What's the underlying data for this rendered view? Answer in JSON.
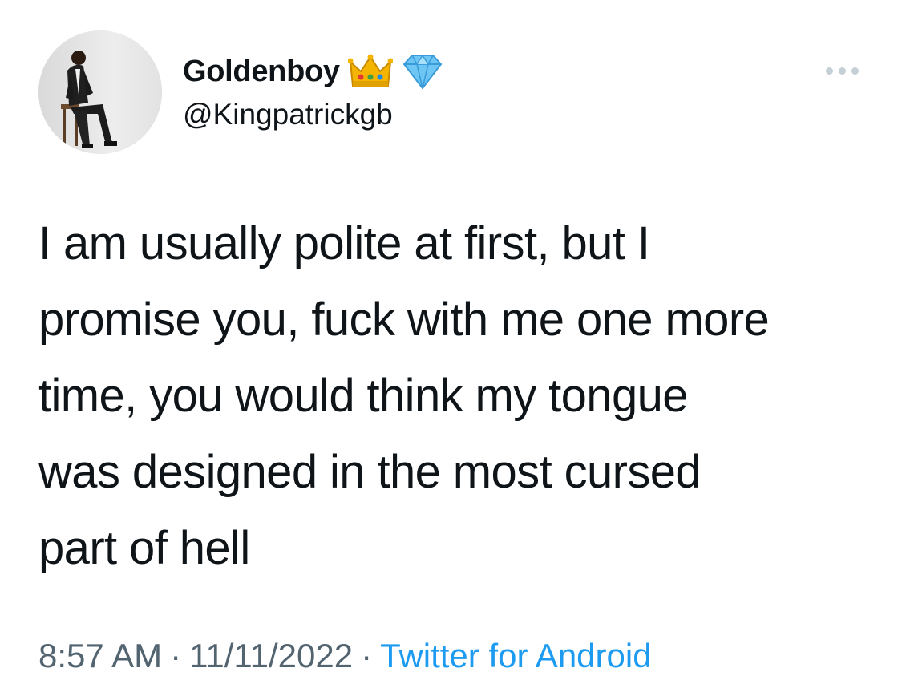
{
  "user": {
    "display_name": "Goldenboy",
    "handle": "@Kingpatrickgb",
    "badges": [
      "crown-emoji",
      "gem-emoji"
    ]
  },
  "tweet": {
    "lines": [
      "I am usually polite at first, but I",
      "promise you, fuck with me one more",
      "time, you would think my tongue",
      "was designed in the most cursed",
      "part of hell"
    ]
  },
  "meta": {
    "time": "8:57 AM",
    "separator": "·",
    "date": "11/11/2022",
    "source": "Twitter for Android"
  },
  "colors": {
    "text": "#0f1419",
    "secondary": "#536471",
    "link": "#1d9bf0"
  }
}
